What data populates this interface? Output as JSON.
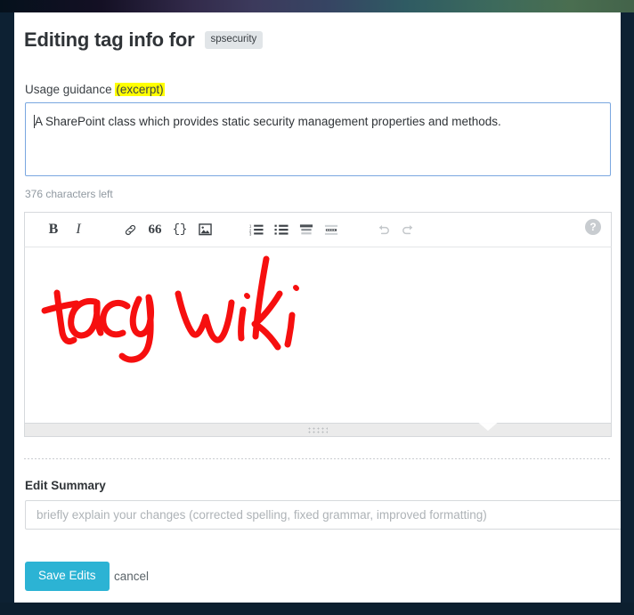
{
  "header": {
    "title": "Editing tag info for",
    "tag": "spsecurity"
  },
  "guidance": {
    "label_prefix": "Usage guidance ",
    "label_highlight": "(excerpt)",
    "excerpt_value": "A SharePoint class which provides static security management properties and methods.",
    "characters_left": "376 characters left"
  },
  "toolbar": {
    "bold": "B",
    "italic": "I",
    "link": "link-glyph",
    "quote": "66",
    "code": "{}",
    "image": "image-glyph",
    "numbered_list": "numbered-list-glyph",
    "bulleted_list": "bulleted-list-glyph",
    "heading": "heading-glyph",
    "horizontal_rule": "hr-glyph",
    "undo": "undo-glyph",
    "redo": "redo-glyph",
    "help": "?"
  },
  "editor": {
    "ink_color": "#f60f0f",
    "ink_words": [
      "tag",
      "wiki"
    ]
  },
  "summary": {
    "label": "Edit Summary",
    "placeholder": "briefly explain your changes (corrected spelling, fixed grammar, improved formatting)",
    "value": ""
  },
  "actions": {
    "save_label": "Save Edits",
    "cancel_label": "cancel",
    "save_color": "#2cb3d4"
  },
  "chrome": {
    "rail_color": "#0d2133",
    "bottom_bar_color": "#0c1f2f"
  }
}
